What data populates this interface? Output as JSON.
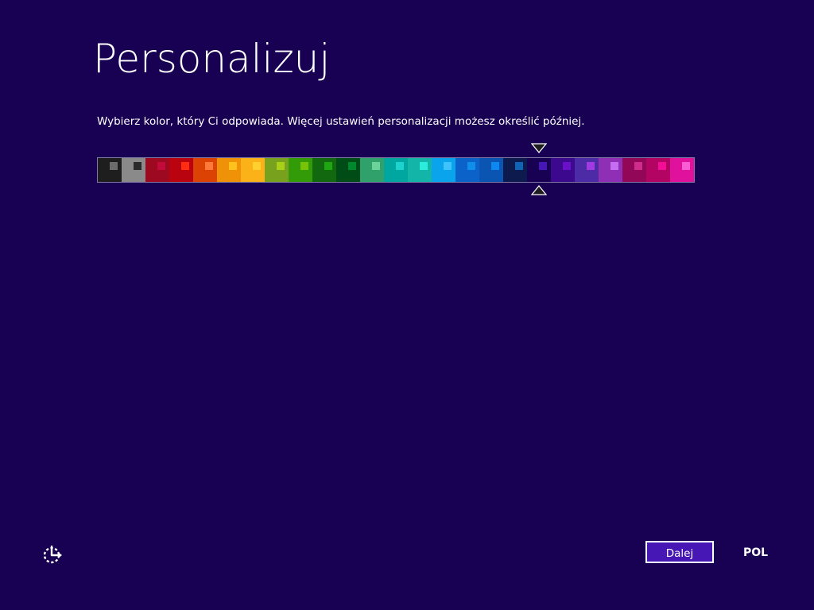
{
  "page": {
    "title": "Personalizuj",
    "instruction": "Wybierz kolor, który Ci odpowiada. Więcej ustawień personalizacji możesz określić później."
  },
  "palette": {
    "selected_index": 18,
    "swatches": [
      {
        "bg": "#1e1e1e",
        "accent": "#6c6c6c"
      },
      {
        "bg": "#8a8a8a",
        "accent": "#2a2a2a"
      },
      {
        "bg": "#9d0921",
        "accent": "#c20a3b"
      },
      {
        "bg": "#b9030f",
        "accent": "#ff2e12"
      },
      {
        "bg": "#dc4203",
        "accent": "#ff7a3a"
      },
      {
        "bg": "#f09208",
        "accent": "#ffc11e"
      },
      {
        "bg": "#fbb218",
        "accent": "#ffd02e"
      },
      {
        "bg": "#78a11e",
        "accent": "#a9d018"
      },
      {
        "bg": "#339a08",
        "accent": "#78c20a"
      },
      {
        "bg": "#12680f",
        "accent": "#20a613"
      },
      {
        "bg": "#004c16",
        "accent": "#00892c"
      },
      {
        "bg": "#31a16c",
        "accent": "#6bd39a"
      },
      {
        "bg": "#00a6a0",
        "accent": "#1ed2cd"
      },
      {
        "bg": "#13b5a8",
        "accent": "#2cecdc"
      },
      {
        "bg": "#0aa4ec",
        "accent": "#3ec3fd"
      },
      {
        "bg": "#0b63ca",
        "accent": "#118deb"
      },
      {
        "bg": "#0a54b2",
        "accent": "#0c88f0"
      },
      {
        "bg": "#0d1a4e",
        "accent": "#1163b4"
      },
      {
        "bg": "#180052",
        "accent": "#4617b4"
      },
      {
        "bg": "#3c098e",
        "accent": "#6a11c8"
      },
      {
        "bg": "#4e2ba6",
        "accent": "#a13ae0"
      },
      {
        "bg": "#8e2fb6",
        "accent": "#c66ef0"
      },
      {
        "bg": "#930758",
        "accent": "#cf2d8c"
      },
      {
        "bg": "#b30464",
        "accent": "#f20f96"
      },
      {
        "bg": "#e0119c",
        "accent": "#fb5ed3"
      }
    ]
  },
  "footer": {
    "next_label": "Dalej",
    "language": "POL",
    "ease_icon": "ease-of-access-icon"
  },
  "colors": {
    "background": "#180052",
    "button_bg": "#4617b4",
    "palette_border": "#7f76a6"
  }
}
